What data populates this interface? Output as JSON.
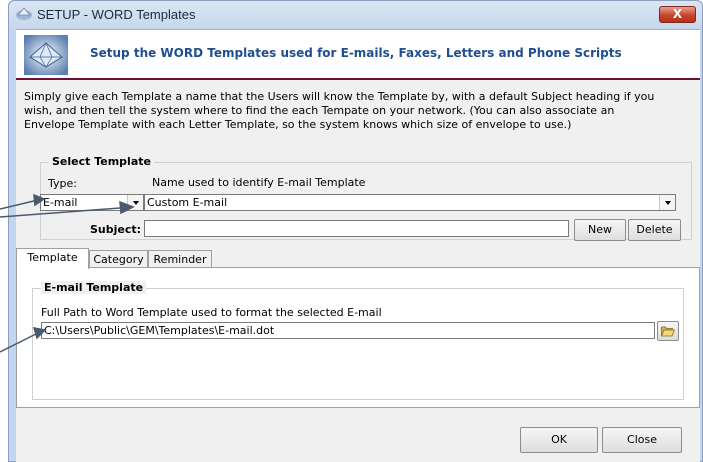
{
  "window": {
    "title": "SETUP - WORD Templates",
    "close_label": "X"
  },
  "banner": {
    "text": "Setup the WORD Templates used for E-mails, Faxes, Letters and Phone Scripts"
  },
  "intro": {
    "lines": [
      "Simply give each Template a name that the Users will know the Template by, with a default Subject heading if you",
      "wish, and then tell the system where to find the each Tempate on your network.  (You can also associate an",
      "Envelope Template with each Letter Template, so the system knows which size of envelope to use.)"
    ]
  },
  "select_template": {
    "legend": "Select Template",
    "type_label": "Type:",
    "type_value": "E-mail",
    "name_label": "Name used to identify E-mail Template",
    "name_value": "Custom E-mail",
    "subject_label": "Subject:",
    "subject_value": "",
    "new_label": "New",
    "delete_label": "Delete"
  },
  "tabs": [
    {
      "label": "Template",
      "active": true
    },
    {
      "label": "Category",
      "active": false
    },
    {
      "label": "Reminder",
      "active": false
    }
  ],
  "email_template": {
    "legend": "E-mail Template",
    "path_label": "Full Path to Word Template used to format the selected E-mail",
    "path_value": "C:\\Users\\Public\\GEM\\Templates\\E-mail.dot",
    "browse_icon": "folder-open-icon"
  },
  "footer": {
    "ok_label": "OK",
    "close_label": "Close"
  },
  "colors": {
    "banner_text": "#1f4e91",
    "banner_rule": "#6b1038",
    "close_button": "#c7442c",
    "window_frame": "#c3d6ee"
  }
}
